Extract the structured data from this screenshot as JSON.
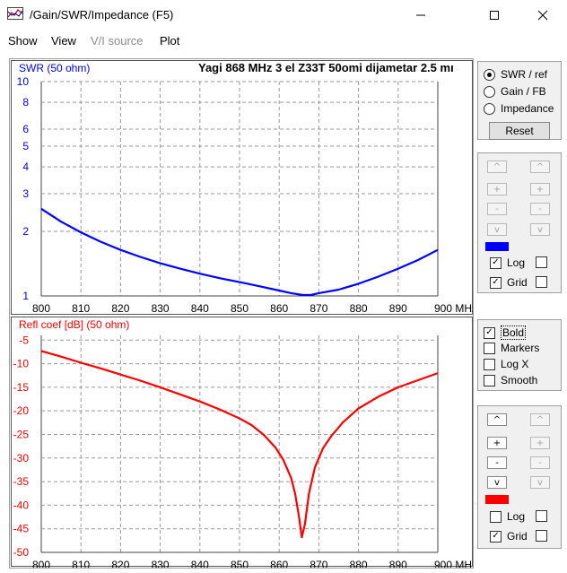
{
  "window": {
    "title": "/Gain/SWR/Impedance (F5)",
    "minimize": "—",
    "maximize": "☐",
    "close": "✕"
  },
  "menu": {
    "show": "Show",
    "view": "View",
    "vi_source": "V/I source",
    "plot": "Plot"
  },
  "mode_panel": {
    "swr": "SWR / ref",
    "gain": "Gain / FB",
    "impedance": "Impedance",
    "reset": "Reset",
    "selected": "swr"
  },
  "axis_panel_top": {
    "up": "^",
    "plus": "+",
    "minus": "-",
    "down": "v",
    "log": "Log",
    "grid": "Grid",
    "log_checked": true,
    "grid_checked": true,
    "color": "#0000ff"
  },
  "options_panel": {
    "bold": "Bold",
    "markers": "Markers",
    "logx": "Log X",
    "smooth": "Smooth",
    "bold_checked": true
  },
  "axis_panel_bottom": {
    "up": "^",
    "plus": "+",
    "minus": "-",
    "down": "v",
    "log": "Log",
    "grid": "Grid",
    "log_checked": false,
    "grid_checked": true,
    "color": "#ff0000"
  },
  "chart_data": [
    {
      "type": "line",
      "title": "Yagi 868 MHz 3 el Z33T 50omi dijametar 2.5 mı",
      "ylabel": "SWR (50 ohm)",
      "xlabel": "MHz",
      "x_tick_labels": [
        "800",
        "810",
        "820",
        "830",
        "840",
        "850",
        "860",
        "870",
        "880",
        "890",
        "900 MHz"
      ],
      "y_tick_labels": [
        "10",
        "8",
        "6",
        "5",
        "4",
        "3",
        "2",
        "1"
      ],
      "y_ticks": [
        10,
        8,
        6,
        5,
        4,
        3,
        2,
        1
      ],
      "ylim": [
        1,
        10
      ],
      "yscale": "log",
      "xlim": [
        800,
        900
      ],
      "grid": true,
      "color": "#0000ff",
      "series": [
        {
          "x": [
            800,
            805,
            810,
            815,
            820,
            825,
            830,
            835,
            840,
            845,
            850,
            855,
            860,
            863,
            866,
            868,
            870,
            875,
            880,
            885,
            890,
            895,
            900
          ],
          "values": [
            2.55,
            2.22,
            1.98,
            1.79,
            1.64,
            1.52,
            1.42,
            1.34,
            1.27,
            1.21,
            1.16,
            1.11,
            1.06,
            1.03,
            1.01,
            1.01,
            1.03,
            1.07,
            1.14,
            1.23,
            1.34,
            1.47,
            1.64
          ]
        }
      ]
    },
    {
      "type": "line",
      "ylabel": "Refl coef [dB] (50 ohm)",
      "xlabel": "MHz",
      "x_tick_labels": [
        "800",
        "810",
        "820",
        "830",
        "840",
        "850",
        "860",
        "870",
        "880",
        "890",
        "900 MHz"
      ],
      "y_tick_labels": [
        "-5",
        "-10",
        "-15",
        "-20",
        "-25",
        "-30",
        "-35",
        "-40",
        "-45",
        "-50"
      ],
      "y_ticks": [
        -5,
        -10,
        -15,
        -20,
        -25,
        -30,
        -35,
        -40,
        -45,
        -50
      ],
      "ylim": [
        -50,
        -4
      ],
      "xlim": [
        800,
        900
      ],
      "grid": true,
      "color": "#ff0000",
      "series": [
        {
          "x": [
            800,
            805,
            810,
            815,
            820,
            825,
            830,
            835,
            840,
            845,
            850,
            853,
            856,
            859,
            861,
            863,
            864,
            865,
            865.7,
            866.5,
            867.5,
            869,
            871,
            873,
            876,
            880,
            885,
            890,
            895,
            900
          ],
          "values": [
            -7.3,
            -8.5,
            -9.8,
            -11.0,
            -12.3,
            -13.6,
            -15.0,
            -16.5,
            -18.0,
            -19.7,
            -21.6,
            -23.0,
            -25.0,
            -27.7,
            -30.3,
            -34.2,
            -37.5,
            -42.5,
            -46.8,
            -44.0,
            -37.5,
            -32.0,
            -28.0,
            -25.5,
            -22.5,
            -19.5,
            -17.0,
            -15.0,
            -13.5,
            -12.0
          ]
        }
      ]
    }
  ]
}
